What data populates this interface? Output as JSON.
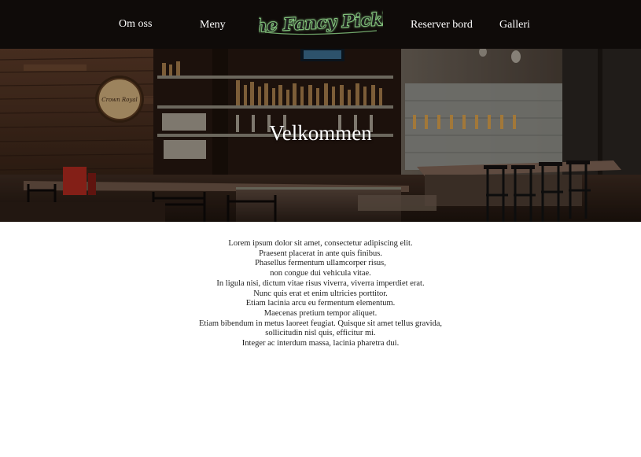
{
  "nav": {
    "left_items": [
      {
        "label": "Om oss"
      },
      {
        "label": "Meny"
      }
    ],
    "right_items": [
      {
        "label": "Reserver bord"
      },
      {
        "label": "Galleri"
      }
    ],
    "logo_text": "The Fancy Pickle",
    "logo_colors": {
      "fill": "#1a1a1a",
      "glow": "#8fe08a",
      "outline": "#ffffff"
    },
    "background_color": "#0f0b09"
  },
  "hero": {
    "title": "Velkommen",
    "image_subject": "bar interior",
    "barrel_label": "Crown Royal"
  },
  "content": {
    "lines": [
      "Lorem ipsum dolor sit amet, consectetur adipiscing elit.",
      "Praesent placerat in ante quis finibus.",
      "Phasellus fermentum ullamcorper risus,",
      "non congue dui vehicula vitae.",
      "In ligula nisi, dictum vitae risus viverra, viverra imperdiet erat.",
      "Nunc quis erat et enim ultricies porttitor.",
      "Etiam lacinia arcu eu fermentum elementum.",
      "Maecenas pretium tempor aliquet.",
      "Etiam bibendum in metus laoreet feugiat. Quisque sit amet tellus gravida,",
      "sollicitudin nisl quis, efficitur mi.",
      "Integer ac interdum massa, lacinia pharetra dui."
    ]
  }
}
